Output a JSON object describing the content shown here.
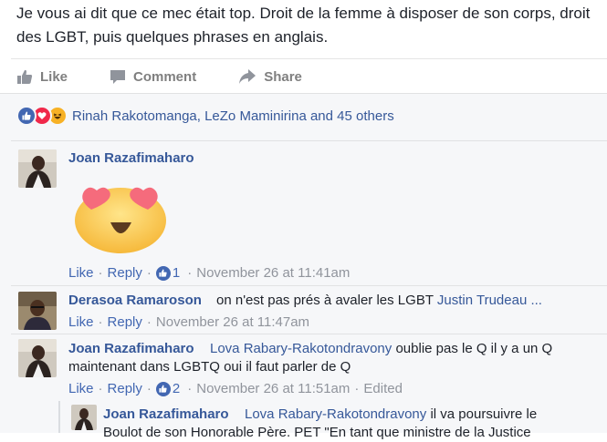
{
  "post": {
    "text": "Je vous ai dit que ce mec était top. Droit de la femme à disposer de son corps, droit des LGBT, puis quelques phrases en anglais."
  },
  "actions": {
    "like_label": "Like",
    "comment_label": "Comment",
    "share_label": "Share"
  },
  "reactions": {
    "summary": "Rinah Rakotomanga, LeZo Maminirina and 45 others"
  },
  "common": {
    "like_label": "Like",
    "reply_label": "Reply",
    "dot": "·"
  },
  "comments": [
    {
      "author": "Joan Razafimaharo",
      "sticker": "heart-eyes-emoji",
      "like_count": "1",
      "timestamp": "November 26 at 11:41am"
    },
    {
      "author": "Derasoa Ramaroson",
      "text": "on n'est pas prés à avaler les LGBT",
      "mention": "Justin Trudeau ...",
      "timestamp": "November 26 at 11:47am"
    },
    {
      "author": "Joan Razafimaharo",
      "mention": "Lova Rabary-Rakotondravony",
      "text_line1": "oublie pas le Q il y a un Q",
      "text_line2": "maintenant dans LGBTQ oui il faut parler de Q",
      "like_count": "2",
      "timestamp": "November 26 at 11:51am",
      "edited": "Edited"
    },
    {
      "author": "Joan Razafimaharo",
      "mention": "Lova Rabary-Rakotondravony",
      "text_line1": "il va poursuivre le",
      "text_line2": "Boulot de son Honorable Père. PET \"En tant que ministre de la Justice"
    }
  ],
  "colors": {
    "link_blue": "#365899",
    "meta_gray": "#90949c",
    "like_blue": "#4267b2",
    "love_red": "#f0284a",
    "haha_yellow": "#f7b125"
  }
}
